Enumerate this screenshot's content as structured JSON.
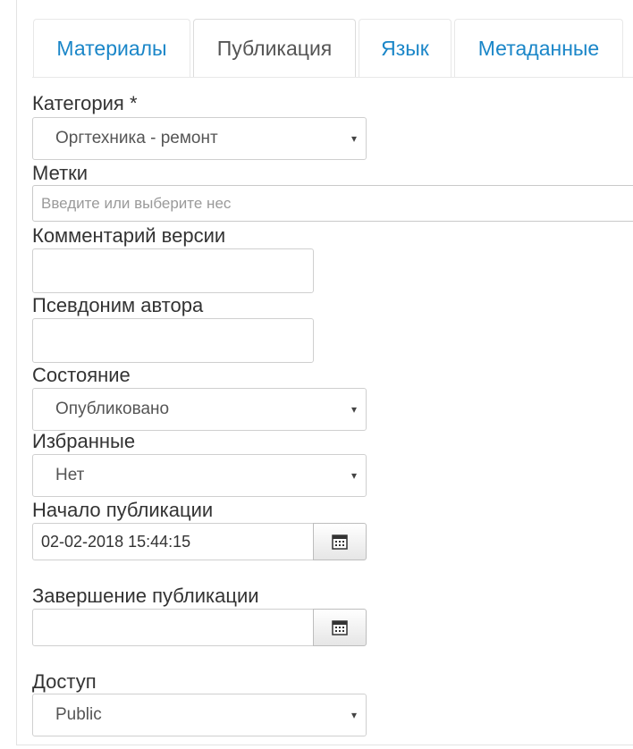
{
  "tabs": [
    {
      "label": "Материалы",
      "active": false
    },
    {
      "label": "Публикация",
      "active": true
    },
    {
      "label": "Язык",
      "active": false
    },
    {
      "label": "Метаданные",
      "active": false
    }
  ],
  "fields": {
    "category": {
      "label": "Категория *",
      "value": "Оргтехника - ремонт"
    },
    "tags": {
      "label": "Метки",
      "placeholder": "Введите или выберите нес"
    },
    "version_note": {
      "label": "Комментарий версии",
      "value": ""
    },
    "author_alias": {
      "label": "Псевдоним автора",
      "value": ""
    },
    "state": {
      "label": "Состояние",
      "value": "Опубликовано"
    },
    "featured": {
      "label": "Избранные",
      "value": "Нет"
    },
    "publish_up": {
      "label": "Начало публикации",
      "value": "02-02-2018 15:44:15"
    },
    "publish_down": {
      "label": "Завершение публикации",
      "value": ""
    },
    "access": {
      "label": "Доступ",
      "value": "Public"
    }
  },
  "icons": {
    "caret": "▾",
    "calendar": "calendar-icon"
  }
}
